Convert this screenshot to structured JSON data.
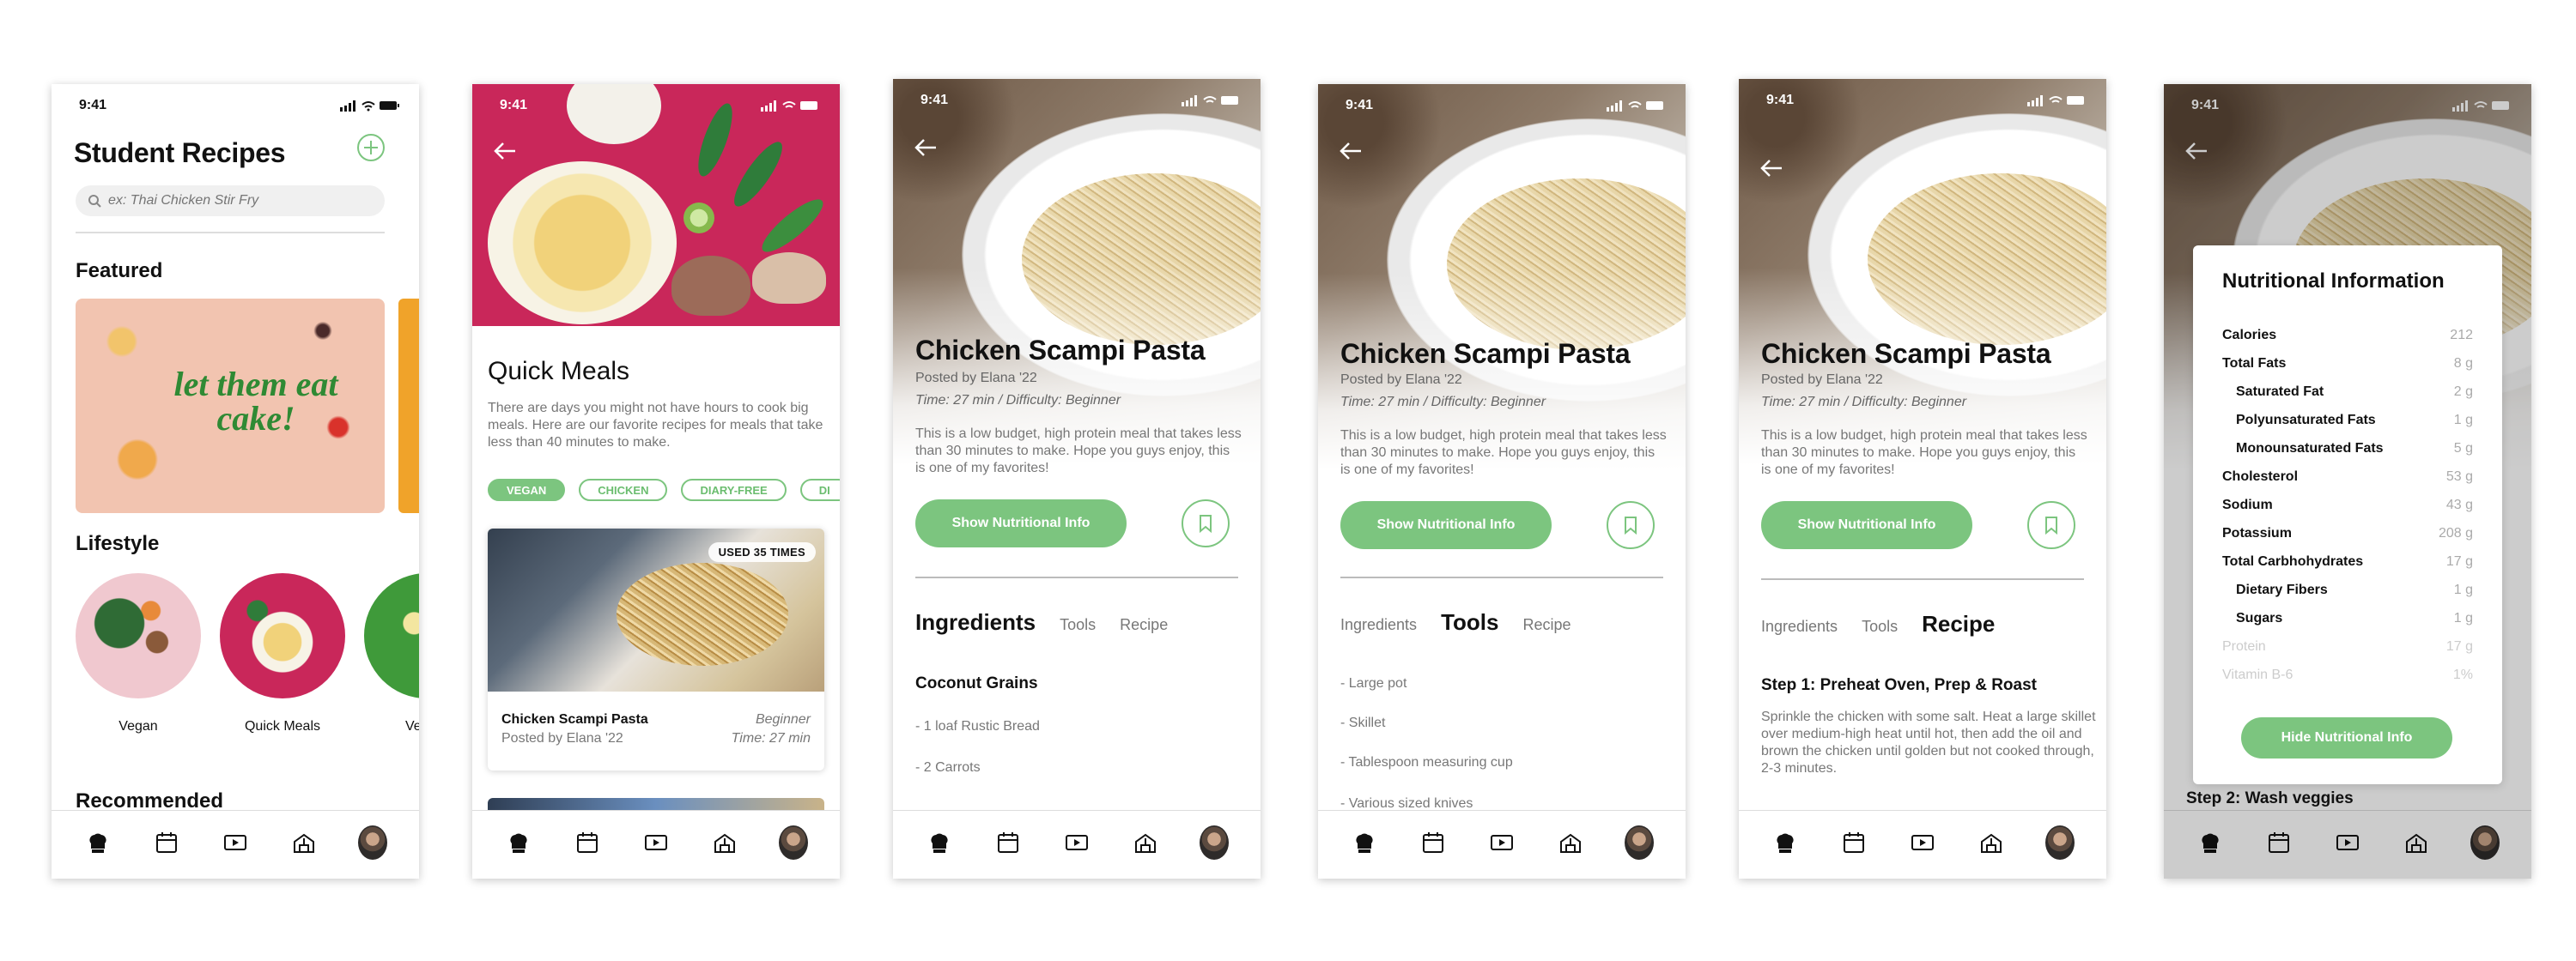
{
  "status": {
    "time": "9:41"
  },
  "home": {
    "title": "Student Recipes",
    "search_placeholder": "ex: Thai Chicken Stir Fry",
    "featured_heading": "Featured",
    "featured_card_text": "let them eat cake!",
    "lifestyle_heading": "Lifestyle",
    "categories": [
      "Vegan",
      "Quick Meals",
      "Ve"
    ],
    "recommended_heading": "Recommended"
  },
  "quick_meals": {
    "title": "Quick Meals",
    "description": "There are days you might not have hours to cook big meals. Here are our favorite recipes for meals that take less than 40 minutes to make.",
    "chips": [
      "VEGAN",
      "CHICKEN",
      "DIARY-FREE",
      "DI"
    ],
    "card": {
      "badge": "USED 35 TIMES",
      "name": "Chicken Scampi Pasta",
      "posted_by": "Posted by Elana '22",
      "difficulty": "Beginner",
      "time": "Time: 27 min"
    }
  },
  "recipe": {
    "title": "Chicken Scampi Pasta",
    "posted_by": "Posted by Elana '22",
    "meta": "Time: 27 min / Difficulty: Beginner",
    "description": "This is a low budget, high protein meal that takes less than 30 minutes to make. Hope you guys enjoy, this is one of my favorites!",
    "show_nutrition": "Show Nutritional Info",
    "tabs": [
      "Ingredients",
      "Tools",
      "Recipe"
    ],
    "ingredients_heading": "Coconut Grains",
    "ingredients": [
      "- 1 loaf Rustic Bread",
      "- 2 Carrots"
    ],
    "tools": [
      "- Large pot",
      "- Skillet",
      "- Tablespoon measuring cup",
      "- Various sized knives"
    ],
    "step1_title": "Step 1: Preheat Oven, Prep & Roast",
    "step1_text": "Sprinkle the chicken with some salt. Heat a large skillet over medium-high heat until hot, then add the oil and brown the chicken until golden but not cooked through, 2-3 minutes.",
    "step2_title": "Step 2: Wash veggies"
  },
  "nutrition": {
    "title": "Nutritional Information",
    "rows": [
      {
        "label": "Calories",
        "value": "212",
        "sub": false
      },
      {
        "label": "Total Fats",
        "value": "8 g",
        "sub": false
      },
      {
        "label": "Saturated Fat",
        "value": "2 g",
        "sub": true
      },
      {
        "label": "Polyunsaturated Fats",
        "value": "1 g",
        "sub": true
      },
      {
        "label": "Monounsaturated Fats",
        "value": "5 g",
        "sub": true
      },
      {
        "label": "Cholesterol",
        "value": "53 g",
        "sub": false
      },
      {
        "label": "Sodium",
        "value": "43 g",
        "sub": false
      },
      {
        "label": "Potassium",
        "value": "208 g",
        "sub": false
      },
      {
        "label": "Total Carbhohydrates",
        "value": "17 g",
        "sub": false
      },
      {
        "label": "Dietary Fibers",
        "value": "1 g",
        "sub": true
      },
      {
        "label": "Sugars",
        "value": "1 g",
        "sub": true
      },
      {
        "label": "Protein",
        "value": "17 g",
        "sub": false
      },
      {
        "label": "Vitamin B-6",
        "value": "1%",
        "sub": false
      }
    ],
    "hide_button": "Hide Nutritional Info"
  },
  "tabbar": {
    "icons": [
      "chef-hat-icon",
      "calendar-icon",
      "video-icon",
      "community-icon",
      "profile-avatar"
    ]
  },
  "colors": {
    "accent": "#7cc57f",
    "pink": "#c9275a",
    "text": "#111111",
    "muted": "#777777"
  }
}
